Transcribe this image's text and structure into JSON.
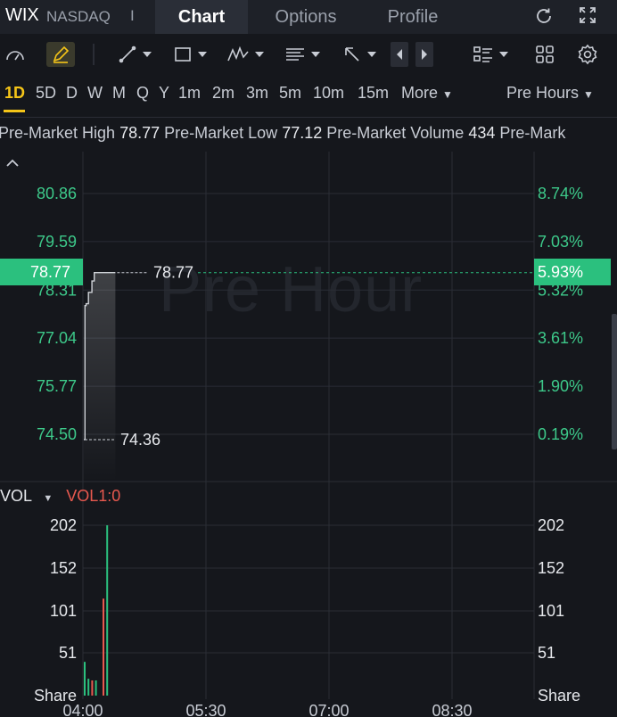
{
  "header": {
    "ticker": "WIX",
    "exchange": "NASDAQ",
    "separator": "I",
    "tabs": [
      {
        "label": "Chart",
        "active": true
      },
      {
        "label": "Options",
        "active": false
      },
      {
        "label": "Profile",
        "active": false
      }
    ]
  },
  "periods": {
    "items": [
      "1D",
      "5D",
      "D",
      "W",
      "M",
      "Q",
      "Y",
      "1m",
      "2m",
      "3m",
      "5m",
      "10m",
      "15m",
      "More"
    ],
    "active": "1D",
    "session_selector": "Pre Hours"
  },
  "stats": {
    "high_label": "Pre-Market High",
    "high_value": "78.77",
    "low_label": "Pre-Market Low",
    "low_value": "77.12",
    "volume_label": "Pre-Market Volume",
    "volume_value": "434",
    "trailing_label": "Pre-Mark"
  },
  "price_chart": {
    "watermark": "Pre Hour",
    "left_axis": [
      "80.86",
      "79.59",
      "78.31",
      "77.04",
      "75.77",
      "74.50"
    ],
    "right_axis": [
      "8.74%",
      "7.03%",
      "5.32%",
      "3.61%",
      "1.90%",
      "0.19%"
    ],
    "current_price": "78.77",
    "current_pct": "5.93%",
    "high_marker": "78.77",
    "low_marker": "74.36",
    "time_labels": [
      "04:00",
      "05:30",
      "07:00",
      "08:30"
    ],
    "line_color": "#d0d3d8",
    "up_color": "#2bc07e",
    "down_color": "#e8594f"
  },
  "volume": {
    "label": "VOL",
    "indicator": "VOL1:0",
    "left_axis": [
      "202",
      "152",
      "101",
      "51",
      "Share"
    ],
    "right_axis": [
      "202",
      "152",
      "101",
      "51",
      "Share"
    ]
  },
  "chart_data": {
    "type": "line",
    "x": [
      "04:00",
      "04:02",
      "04:04",
      "04:06",
      "04:08",
      "04:10",
      "04:12",
      "04:14",
      "04:16",
      "04:18",
      "04:20",
      "04:22",
      "04:24",
      "04:26",
      "04:28",
      "04:30",
      "04:32",
      "04:34",
      "04:36"
    ],
    "series": [
      {
        "values": [
          74.36,
          77.9,
          77.95,
          77.95,
          78.25,
          78.25,
          78.25,
          78.55,
          78.55,
          78.77,
          78.77,
          78.77,
          78.77,
          78.77,
          78.77,
          78.77,
          78.77,
          78.77,
          78.77
        ]
      }
    ],
    "ylim": [
      74.5,
      80.86
    ],
    "volume": {
      "x": [
        "04:00",
        "04:02",
        "04:04",
        "04:06",
        "04:08",
        "04:10",
        "04:12"
      ],
      "values": [
        40,
        20,
        18,
        18,
        0,
        115,
        202
      ],
      "direction": [
        "up",
        "up",
        "down",
        "up",
        "down",
        "down",
        "up"
      ],
      "ylim": [
        0,
        202
      ]
    },
    "xlabels": [
      "04:00",
      "05:30",
      "07:00",
      "08:30"
    ]
  },
  "icons": [
    "refresh-icon",
    "fullscreen-icon",
    "gauge-icon",
    "pencil-icon",
    "line-tool-icon",
    "rectangle-tool-icon",
    "pattern-tool-icon",
    "fib-tool-icon",
    "arrow-tool-icon",
    "prev-arrow-icon",
    "next-arrow-icon",
    "list-layout-icon",
    "grid-layout-icon",
    "settings-gear-icon"
  ]
}
